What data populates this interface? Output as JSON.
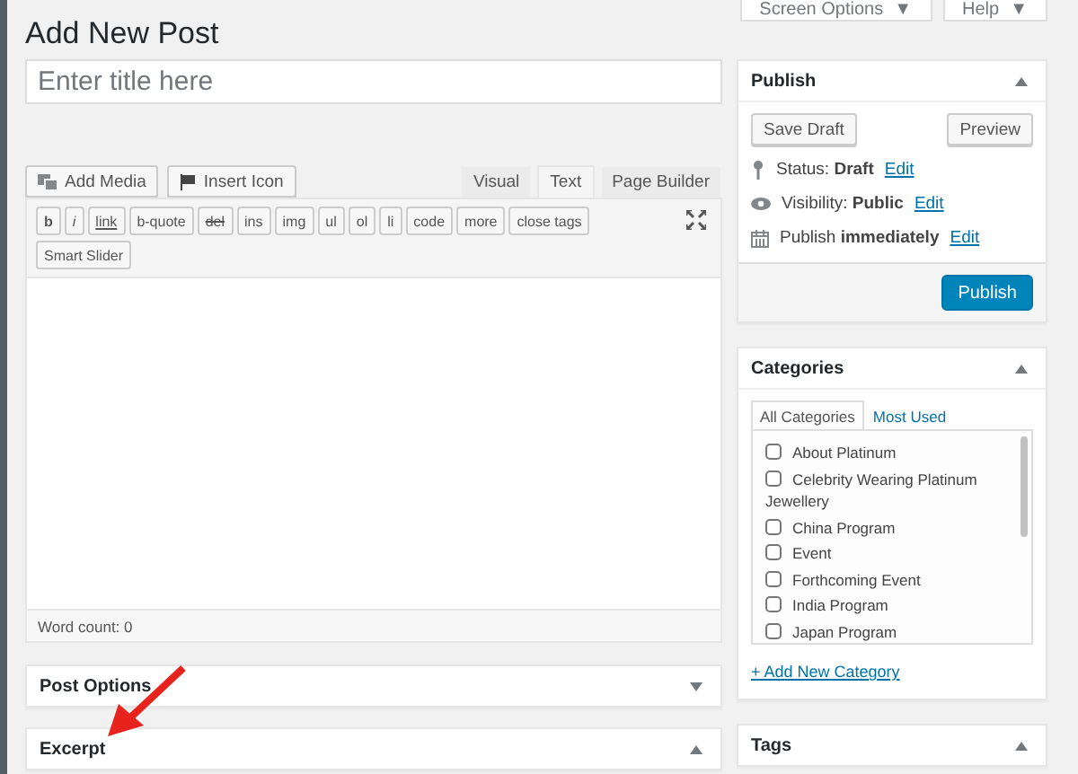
{
  "top_buttons": [
    {
      "label": "Screen Options",
      "caret": "▼"
    },
    {
      "label": "Help",
      "caret": "▼"
    }
  ],
  "page_title": "Add New Post",
  "title_field": {
    "placeholder": "Enter title here"
  },
  "media_buttons": [
    {
      "kind": "media",
      "label": "Add Media"
    },
    {
      "kind": "flag",
      "label": "Insert Icon"
    }
  ],
  "editor_tabs": [
    {
      "label": "Visual",
      "selected": false
    },
    {
      "label": "Text",
      "selected": true
    },
    {
      "label": "Page Builder",
      "selected": false
    }
  ],
  "quicktags": [
    "b",
    "i",
    "link",
    "b-quote",
    "del",
    "ins",
    "img",
    "ul",
    "ol",
    "li",
    "code",
    "more",
    "close tags",
    "Smart Slider"
  ],
  "word_count": "Word count: 0",
  "boxes": [
    {
      "title": "Post Options",
      "expanded": false
    },
    {
      "title": "Excerpt",
      "expanded": true
    }
  ],
  "publish": {
    "title": "Publish",
    "save_draft": "Save Draft",
    "preview": "Preview",
    "rows": [
      {
        "kind": "pin",
        "label": "Status:",
        "value": "Draft",
        "link": "Edit"
      },
      {
        "kind": "eye",
        "label": "Visibility:",
        "value": "Public",
        "link": "Edit"
      },
      {
        "kind": "calendar",
        "label": "Publish",
        "value": "immediately",
        "link": "Edit"
      }
    ],
    "button": "Publish"
  },
  "categories": {
    "title": "Categories",
    "tabs": [
      {
        "label": "All Categories",
        "selected": true
      },
      {
        "label": "Most Used",
        "selected": false
      }
    ],
    "items": [
      {
        "label": "About Platinum",
        "checked": false
      },
      {
        "label": "Celebrity Wearing Platinum Jewellery",
        "checked": false
      },
      {
        "label": "China Program",
        "checked": false
      },
      {
        "label": "Event",
        "checked": false
      },
      {
        "label": "Forthcoming Event",
        "checked": false
      },
      {
        "label": "India Program",
        "checked": false
      },
      {
        "label": "Japan Program",
        "checked": false
      }
    ],
    "add_link": "+ Add New Category"
  },
  "tags": {
    "title": "Tags",
    "expanded": true
  }
}
